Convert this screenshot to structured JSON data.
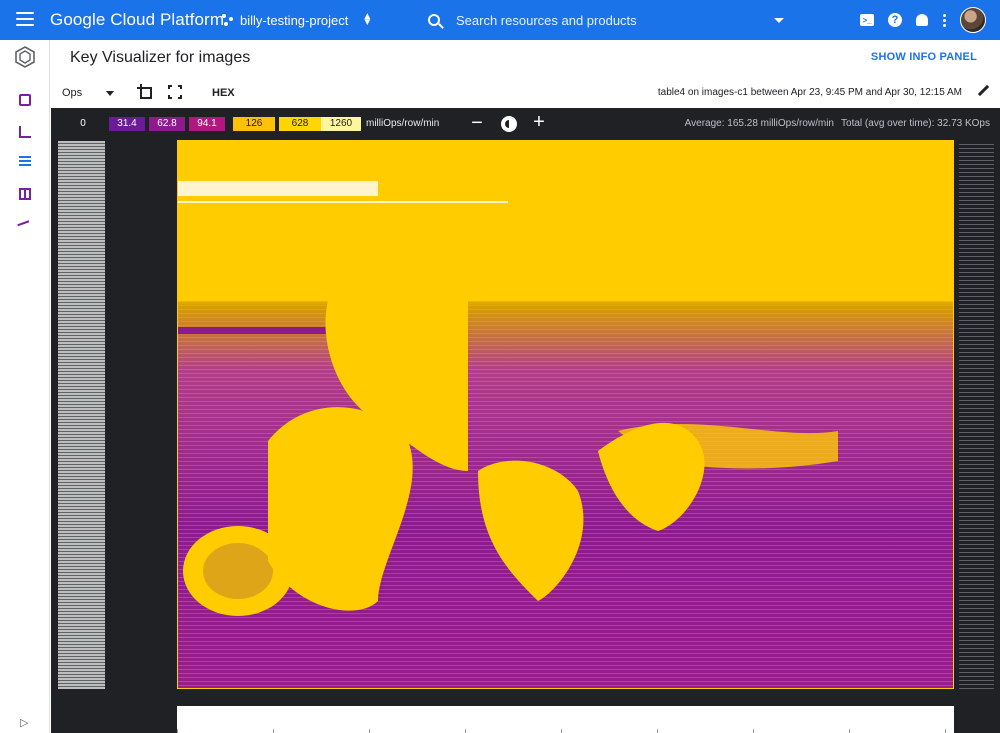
{
  "app": {
    "brand": "Google Cloud Platform",
    "project": "billy-testing-project",
    "search_placeholder": "Search resources and products"
  },
  "header": {
    "title": "Key Visualizer for images",
    "info_panel_button": "SHOW INFO PANEL"
  },
  "toolbar": {
    "metric": "Ops",
    "hex_label": "HEX",
    "range_prefix": "table4 on images-c1",
    "range_between": "between",
    "range_start": "Apr 23, 9:45 PM",
    "range_and": "and",
    "range_end": "Apr 30, 12:15 AM"
  },
  "legend": {
    "steps": [
      {
        "label": "0",
        "bg": "#202124",
        "fg": "#ffffff"
      },
      {
        "label": "31.4",
        "bg": "#6a1b9a",
        "fg": "#ffffff"
      },
      {
        "label": "62.8",
        "bg": "#8e1b8e",
        "fg": "#ffffff"
      },
      {
        "label": "94.1",
        "bg": "#b0187f",
        "fg": "#ffffff"
      },
      {
        "label": "126",
        "bg": "#ffc107",
        "fg": "#202124"
      },
      {
        "label": "628",
        "bg": "#ffd600",
        "fg": "#202124"
      },
      {
        "label": "1260",
        "bg": "#fff59d",
        "fg": "#202124"
      }
    ],
    "unit": "milliOps/row/min",
    "average": "Average: 165.28 milliOps/row/min",
    "total": "Total (avg over time): 32.73 KOps"
  },
  "icons": {
    "menu": "menu-icon",
    "search": "search-icon",
    "terminal": "cloud-shell-icon",
    "help": "help-icon",
    "notifications": "bell-icon",
    "more": "more-vert-icon",
    "crop": "crop-icon",
    "fit": "fit-screen-icon",
    "edit": "pencil-icon",
    "brightness": "brightness-icon"
  },
  "colors": {
    "topbar": "#1a73e8",
    "accent": "#1a73e8",
    "viz_bg": "#202124",
    "heat_high": "#ffcc00",
    "heat_mid": "#8e1b8e"
  }
}
